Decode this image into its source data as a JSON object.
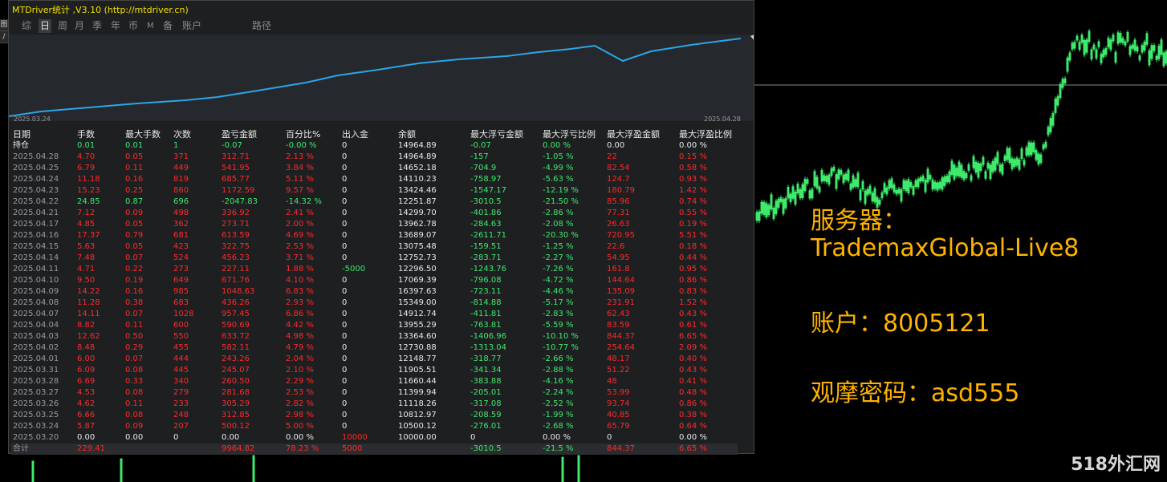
{
  "window": {
    "title": "MTDriver统计 ,V3.10 (http://mtdriver.cn)"
  },
  "left_tools": [
    "图",
    "/"
  ],
  "tabs": [
    {
      "label": "综",
      "active": false
    },
    {
      "label": "日",
      "active": true
    },
    {
      "label": "周",
      "active": false
    },
    {
      "label": "月",
      "active": false
    },
    {
      "label": "季",
      "active": false
    },
    {
      "label": "年",
      "active": false
    },
    {
      "label": "币",
      "active": false
    },
    {
      "label": "M",
      "active": false
    },
    {
      "label": "备",
      "active": false
    },
    {
      "label": "账户",
      "active": false
    },
    {
      "label": "路径",
      "active": false
    }
  ],
  "equity": {
    "start_date": "2025.03.24",
    "end_date": "2025.04.28",
    "line_color": "#2aa6e8"
  },
  "table": {
    "headers": [
      "日期",
      "手数",
      "最大手数",
      "次数",
      "盈亏金额",
      "百分比%",
      "出入金",
      "余额",
      "最大浮亏金额",
      "最大浮亏比例",
      "最大浮盈金额",
      "最大浮盈比例"
    ],
    "holding": [
      "持仓",
      "0.01",
      "0.01",
      "1",
      "-0.07",
      "-0.00 %",
      "0",
      "14964.89",
      "-0.07",
      "0.00 %",
      "0.00",
      "0.00 %"
    ],
    "rows": [
      [
        "2025.04.28",
        "4.70",
        "0.05",
        "371",
        "312.71",
        "2.13 %",
        "0",
        "14964.89",
        "-157",
        "-1.05 %",
        "22",
        "0.15 %"
      ],
      [
        "2025.04.25",
        "6.79",
        "0.11",
        "449",
        "541.95",
        "3.84 %",
        "0",
        "14652.18",
        "-704.9",
        "-4.99 %",
        "82.54",
        "0.58 %"
      ],
      [
        "2025.04.24",
        "11.18",
        "0.16",
        "819",
        "685.77",
        "5.11 %",
        "0",
        "14110.23",
        "-758.97",
        "-5.63 %",
        "124.7",
        "0.93 %"
      ],
      [
        "2025.04.23",
        "15.23",
        "0.25",
        "860",
        "1172.59",
        "9.57 %",
        "0",
        "13424.46",
        "-1547.17",
        "-12.19 %",
        "180.79",
        "1.42 %"
      ],
      [
        "2025.04.22",
        "24.85",
        "0.87",
        "696",
        "-2047.83",
        "-14.32 %",
        "0",
        "12251.87",
        "-3010.5",
        "-21.50 %",
        "85.96",
        "0.74 %"
      ],
      [
        "2025.04.21",
        "7.12",
        "0.09",
        "498",
        "336.92",
        "2.41 %",
        "0",
        "14299.70",
        "-401.86",
        "-2.86 %",
        "77.31",
        "0.55 %"
      ],
      [
        "2025.04.17",
        "4.85",
        "0.05",
        "362",
        "273.71",
        "2.00 %",
        "0",
        "13962.78",
        "-284.63",
        "-2.08 %",
        "26.63",
        "0.19 %"
      ],
      [
        "2025.04.16",
        "17.37",
        "0.79",
        "681",
        "613.59",
        "4.69 %",
        "0",
        "13689.07",
        "-2611.71",
        "-20.30 %",
        "720.95",
        "5.51 %"
      ],
      [
        "2025.04.15",
        "5.63",
        "0.05",
        "423",
        "322.75",
        "2.53 %",
        "0",
        "13075.48",
        "-159.51",
        "-1.25 %",
        "22.6",
        "0.18 %"
      ],
      [
        "2025.04.14",
        "7.48",
        "0.07",
        "524",
        "456.23",
        "3.71 %",
        "0",
        "12752.73",
        "-283.71",
        "-2.27 %",
        "54.95",
        "0.44 %"
      ],
      [
        "2025.04.11",
        "4.71",
        "0.22",
        "273",
        "227.11",
        "1.88 %",
        "-5000",
        "12296.50",
        "-1243.76",
        "-7.26 %",
        "161.8",
        "0.95 %"
      ],
      [
        "2025.04.10",
        "9.50",
        "0.19",
        "649",
        "671.76",
        "4.10 %",
        "0",
        "17069.39",
        "-796.08",
        "-4.72 %",
        "144.64",
        "0.86 %"
      ],
      [
        "2025.04.09",
        "14.22",
        "0.16",
        "985",
        "1048.63",
        "6.83 %",
        "0",
        "16397.63",
        "-723.11",
        "-4.46 %",
        "135.09",
        "0.83 %"
      ],
      [
        "2025.04.08",
        "11.28",
        "0.38",
        "683",
        "436.26",
        "2.93 %",
        "0",
        "15349.00",
        "-814.88",
        "-5.17 %",
        "231.91",
        "1.52 %"
      ],
      [
        "2025.04.07",
        "14.11",
        "0.07",
        "1028",
        "957.45",
        "6.86 %",
        "0",
        "14912.74",
        "-411.81",
        "-2.83 %",
        "62.43",
        "0.43 %"
      ],
      [
        "2025.04.04",
        "8.82",
        "0.11",
        "600",
        "590.69",
        "4.42 %",
        "0",
        "13955.29",
        "-763.81",
        "-5.59 %",
        "83.59",
        "0.61 %"
      ],
      [
        "2025.04.03",
        "12.62",
        "0.50",
        "550",
        "633.72",
        "4.98 %",
        "0",
        "13364.60",
        "-1406.96",
        "-10.10 %",
        "844.37",
        "6.65 %"
      ],
      [
        "2025.04.02",
        "8.48",
        "0.29",
        "455",
        "582.11",
        "4.79 %",
        "0",
        "12730.88",
        "-1313.04",
        "-10.77 %",
        "254.64",
        "2.09 %"
      ],
      [
        "2025.04.01",
        "6.00",
        "0.07",
        "444",
        "243.26",
        "2.04 %",
        "0",
        "12148.77",
        "-318.77",
        "-2.66 %",
        "48.17",
        "0.40 %"
      ],
      [
        "2025.03.31",
        "6.09",
        "0.08",
        "445",
        "245.07",
        "2.10 %",
        "0",
        "11905.51",
        "-341.34",
        "-2.88 %",
        "51.22",
        "0.43 %"
      ],
      [
        "2025.03.28",
        "6.69",
        "0.33",
        "340",
        "260.50",
        "2.29 %",
        "0",
        "11660.44",
        "-383.88",
        "-4.16 %",
        "48",
        "0.41 %"
      ],
      [
        "2025.03.27",
        "4.53",
        "0.08",
        "279",
        "281.68",
        "2.53 %",
        "0",
        "11399.94",
        "-205.01",
        "-2.24 %",
        "53.99",
        "0.48 %"
      ],
      [
        "2025.03.26",
        "4.62",
        "0.11",
        "233",
        "305.29",
        "2.82 %",
        "0",
        "11118.26",
        "-317.08",
        "-2.52 %",
        "93.74",
        "0.86 %"
      ],
      [
        "2025.03.25",
        "6.66",
        "0.08",
        "248",
        "312.85",
        "2.98 %",
        "0",
        "10812.97",
        "-208.59",
        "-1.99 %",
        "40.85",
        "0.38 %"
      ],
      [
        "2025.03.24",
        "5.87",
        "0.09",
        "207",
        "500.12",
        "5.00 %",
        "0",
        "10500.12",
        "-276.01",
        "-2.68 %",
        "65.79",
        "0.64 %"
      ],
      [
        "2025.03.20",
        "0.00",
        "0.00",
        "0",
        "0.00",
        "0.00 %",
        "10000",
        "10000.00",
        "0",
        "0.00 %",
        "0",
        "0.00 %"
      ]
    ],
    "total": [
      "合计",
      "229.41",
      "",
      "",
      "9964.82",
      "78.23 %",
      "5000",
      "",
      "-3010.5",
      "-21.5 %",
      "844.37",
      "6.65 %"
    ]
  },
  "overlay": {
    "server_label": "服务器：",
    "server_value": "TrademaxGlobal-Live8",
    "account": "账户：8005121",
    "password": "观摩密码：asd555"
  },
  "watermark": "518外汇网",
  "colors": {
    "profit": "#ff2a2a",
    "loss": "#3ee96b",
    "overlay": "#ffb300",
    "title": "#f2e200",
    "candles": "#3ee96b"
  }
}
